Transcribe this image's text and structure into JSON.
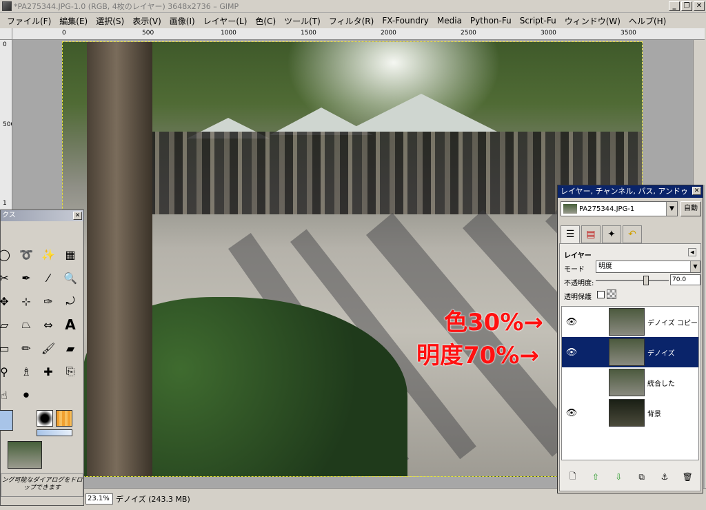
{
  "window": {
    "title": "*PA275344.JPG-1.0 (RGB, 4枚のレイヤー) 3648x2736 – GIMP",
    "min": "_",
    "max": "❐",
    "close": "✕"
  },
  "menu": [
    "ファイル(F)",
    "編集(E)",
    "選択(S)",
    "表示(V)",
    "画像(I)",
    "レイヤー(L)",
    "色(C)",
    "ツール(T)",
    "フィルタ(R)",
    "FX-Foundry",
    "Media",
    "Python-Fu",
    "Script-Fu",
    "ウィンドウ(W)",
    "ヘルプ(H)"
  ],
  "ruler": {
    "h_ticks": [
      "0",
      "500",
      "1000",
      "1500",
      "2000",
      "2500",
      "3000",
      "3500"
    ],
    "v_ticks": [
      "0",
      "500",
      "1"
    ]
  },
  "annotations": {
    "line1": "色30%→",
    "line2": "明度70%→"
  },
  "status": {
    "zoom": "23.1%",
    "text": "デノイズ (243.3 MB)"
  },
  "toolbox": {
    "title": "ツールボックス",
    "title_visible": "クス",
    "drop_hint": "ドッキング可能なダイアログをドロップできます",
    "drop_hint_visible": "ング可能なダイアログをドロップできます"
  },
  "dock": {
    "title": "レイヤー, チャンネル, パス, アンドゥ",
    "image_name": "PA275344.JPG-1",
    "auto_label": "自動",
    "panel_heading": "レイヤー",
    "mode_label": "モード",
    "mode_value": "明度",
    "opacity_label": "不透明度:",
    "opacity_value": "70.0",
    "opacity_fraction": 0.7,
    "lock_label": "透明保護",
    "layers": [
      {
        "name": "デノイズ コピー",
        "visible": true,
        "selected": false
      },
      {
        "name": "デノイズ",
        "visible": true,
        "selected": true
      },
      {
        "name": "統合した",
        "visible": false,
        "selected": false
      },
      {
        "name": "背景",
        "visible": true,
        "selected": false
      }
    ]
  },
  "colors": {
    "selection": "#0a246a",
    "annotation": "#ff1010",
    "fg": "#a8c4e8"
  }
}
